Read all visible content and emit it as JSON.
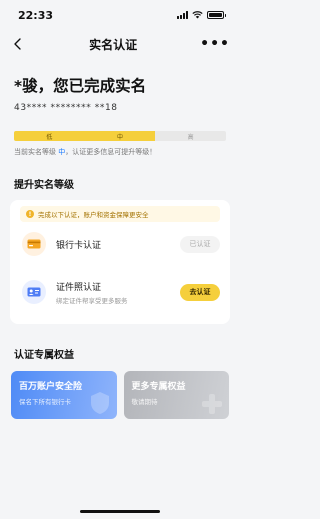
{
  "status_bar": {
    "time": "22:33"
  },
  "nav": {
    "title": "实名认证",
    "more": "•••"
  },
  "hero": {
    "title": "*骏，您已完成实名",
    "id_masked": "43**** ******** **18"
  },
  "level": {
    "segments": [
      "低",
      "中",
      "高"
    ],
    "current_index": 1,
    "note_prefix": "当前实名等级 ",
    "note_current": "中",
    "note_suffix": "，认证更多信息可提升等级！"
  },
  "upgrade": {
    "title": "提升实名等级",
    "tip": "完成以下认证，账户和资金保障更安全",
    "items": [
      {
        "title": "银行卡认证",
        "subtitle": "",
        "button": "已认证",
        "done": true
      },
      {
        "title": "证件照认证",
        "subtitle": "绑定证件帮享受更多服务",
        "button": "去认证",
        "done": false
      }
    ]
  },
  "benefits": {
    "title": "认证专属权益",
    "cards": [
      {
        "title": "百万账户安全险",
        "subtitle": "保名下所有银行卡"
      },
      {
        "title": "更多专属权益",
        "subtitle": "敬请期待"
      }
    ]
  },
  "colors": {
    "accent": "#f5cf3c",
    "link": "#1677ff",
    "blue_card": "#4f8bf6",
    "gray_card": "#b3b5ba"
  }
}
